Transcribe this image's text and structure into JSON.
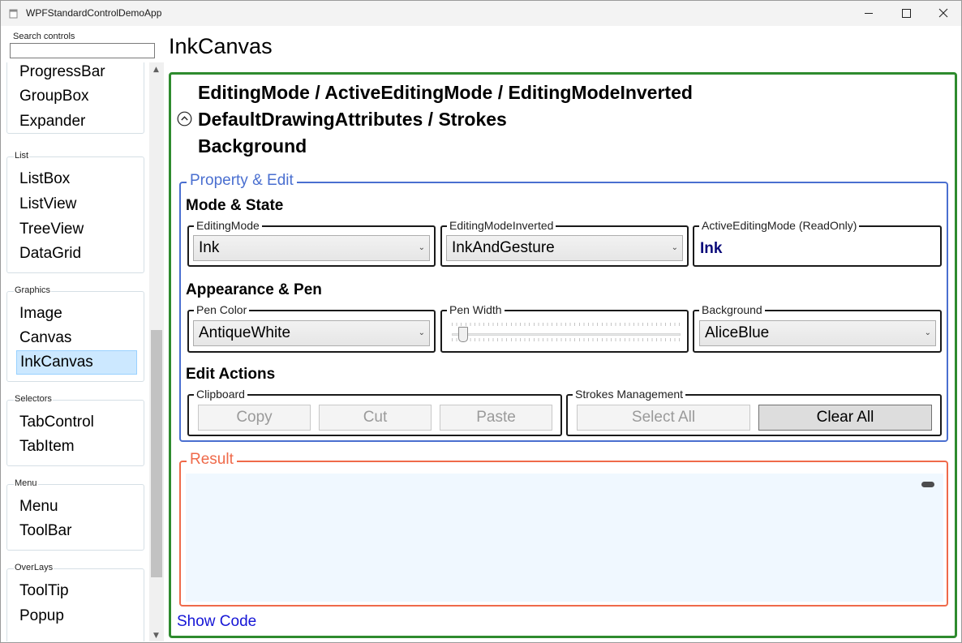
{
  "window": {
    "title": "WPFStandardControlDemoApp"
  },
  "sidebar": {
    "search_label": "Search controls",
    "search_value": "",
    "groups": [
      {
        "label": "",
        "items": [
          "ProgressBar",
          "GroupBox",
          "Expander"
        ]
      },
      {
        "label": "List",
        "items": [
          "ListBox",
          "ListView",
          "TreeView",
          "DataGrid"
        ]
      },
      {
        "label": "Graphics",
        "items": [
          "Image",
          "Canvas",
          "InkCanvas"
        ]
      },
      {
        "label": "Selectors",
        "items": [
          "TabControl",
          "TabItem"
        ]
      },
      {
        "label": "Menu",
        "items": [
          "Menu",
          "ToolBar"
        ]
      },
      {
        "label": "OverLays",
        "items": [
          "ToolTip",
          "Popup"
        ]
      }
    ],
    "selected_item": "InkCanvas"
  },
  "main": {
    "page_title": "InkCanvas",
    "topics": [
      "EditingMode / ActiveEditingMode / EditingModeInverted",
      "DefaultDrawingAttributes / Strokes",
      "Background"
    ],
    "property_edit": {
      "legend": "Property & Edit",
      "mode_state": {
        "title": "Mode & State",
        "editing_mode": {
          "label": "EditingMode",
          "value": "Ink"
        },
        "editing_mode_inverted": {
          "label": "EditingModeInverted",
          "value": "InkAndGesture"
        },
        "active_editing_mode": {
          "label": "ActiveEditingMode (ReadOnly)",
          "value": "Ink"
        }
      },
      "appearance_pen": {
        "title": "Appearance & Pen",
        "pen_color": {
          "label": "Pen Color",
          "value": "AntiqueWhite"
        },
        "pen_width": {
          "label": "Pen Width",
          "level": 0.03
        },
        "background": {
          "label": "Background",
          "value": "AliceBlue"
        }
      },
      "edit_actions": {
        "title": "Edit Actions",
        "clipboard": {
          "label": "Clipboard",
          "copy": "Copy",
          "cut": "Cut",
          "paste": "Paste"
        },
        "strokes_management": {
          "label": "Strokes Management",
          "select_all": "Select All",
          "clear_all": "Clear All"
        }
      }
    },
    "result": {
      "legend": "Result",
      "canvas_background": "#f0f8ff"
    },
    "show_code": "Show Code"
  },
  "colors": {
    "green_frame": "#2e8b2e",
    "property_edit_accent": "#4a6fd0",
    "result_accent": "#ef6a4a",
    "readonly_value": "#0b0b7a",
    "link": "#1515d6",
    "selected_item_bg": "#cce8ff"
  },
  "icons": {
    "app": "window-icon",
    "minimize": "minimize-icon",
    "maximize": "maximize-icon",
    "close": "close-icon",
    "collapse": "chevron-up-circle-icon",
    "dropdown": "chevron-down-icon"
  }
}
